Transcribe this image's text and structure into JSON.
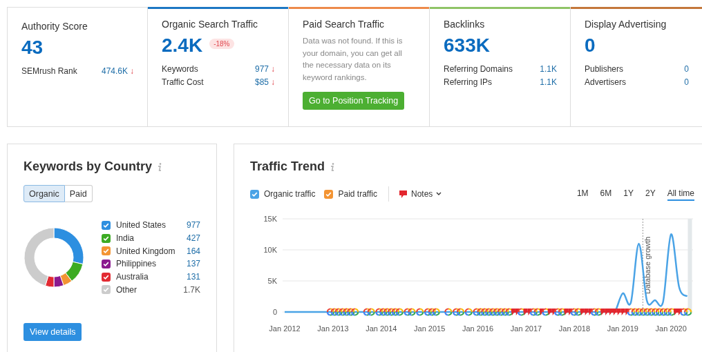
{
  "summary_cards": [
    {
      "title": "Authority Score",
      "value": "43",
      "metrics": [
        {
          "label": "SEMrush Rank",
          "value": "474.6K",
          "trend_icon": "↓"
        }
      ]
    },
    {
      "title": "Organic Search Traffic",
      "color": "#1c77c3",
      "value": "2.4K",
      "badge": "-18%",
      "metrics": [
        {
          "label": "Keywords",
          "value": "977",
          "trend_icon": "↓"
        },
        {
          "label": "Traffic Cost",
          "value": "$85",
          "trend_icon": "↓"
        }
      ]
    },
    {
      "title": "Paid Search Traffic",
      "color": "#ed8a4a",
      "message": "Data was not found. If this is your domain, you can get all the necessary data on its keyword rankings.",
      "button": "Go to Position Tracking"
    },
    {
      "title": "Backlinks",
      "color": "#8fc466",
      "value": "633K",
      "metrics": [
        {
          "label": "Referring Domains",
          "value": "1.1K"
        },
        {
          "label": "Referring IPs",
          "value": "1.1K"
        }
      ]
    },
    {
      "title": "Display Advertising",
      "color": "#c4773a",
      "value": "0",
      "metrics": [
        {
          "label": "Publishers",
          "value": "0"
        },
        {
          "label": "Advertisers",
          "value": "0"
        }
      ]
    }
  ],
  "keywords_by_country": {
    "title": "Keywords by Country",
    "toggle": [
      {
        "label": "Organic",
        "selected": true
      },
      {
        "label": "Paid",
        "selected": false
      }
    ],
    "legend": [
      {
        "label": "United States",
        "value": "977",
        "color": "#2d8fe0",
        "checked": true
      },
      {
        "label": "India",
        "value": "427",
        "color": "#3cab23",
        "checked": true
      },
      {
        "label": "United Kingdom",
        "value": "164",
        "color": "#f39433",
        "checked": true
      },
      {
        "label": "Philippines",
        "value": "137",
        "color": "#8b1a8f",
        "checked": true
      },
      {
        "label": "Australia",
        "value": "131",
        "color": "#e22a32",
        "checked": true
      },
      {
        "label": "Other",
        "value": "1.7K",
        "color": "#cccccc",
        "checked": true
      }
    ],
    "chart_data": {
      "type": "donut",
      "series": [
        {
          "values": [
            28.6,
            11.1,
            5,
            5.3,
            4.7,
            45.3
          ]
        }
      ]
    },
    "button": "View details"
  },
  "traffic_trend": {
    "title": "Traffic Trend",
    "toggles": [
      {
        "label": "Organic traffic",
        "checked": true,
        "color": "#4aa3e6"
      },
      {
        "label": "Paid traffic",
        "checked": true,
        "color": "#f39433"
      }
    ],
    "notes_button": "Notes",
    "periods": [
      {
        "label": "1M",
        "selected": false
      },
      {
        "label": "6M",
        "selected": false
      },
      {
        "label": "1Y",
        "selected": false
      },
      {
        "label": "2Y",
        "selected": false
      },
      {
        "label": "All time",
        "selected": true
      }
    ],
    "chart_data": {
      "type": "line",
      "categories": [
        "Jan 2012",
        null,
        null,
        null,
        null,
        null,
        "Jan 2013",
        null,
        null,
        null,
        null,
        null,
        "Jan 2014",
        null,
        null,
        null,
        null,
        null,
        "Jan 2015",
        null,
        null,
        null,
        null,
        null,
        "Jan 2016",
        null,
        null,
        null,
        null,
        null,
        "Jan 2017",
        null,
        null,
        null,
        null,
        null,
        "Jan 2018",
        null,
        null,
        null,
        null,
        null,
        "Jan 2019",
        null,
        null,
        null,
        null,
        null,
        "Jan 2020",
        null,
        null
      ],
      "series": [
        {
          "color": "#4aa3e6",
          "values": [
            0,
            0,
            0,
            0,
            0,
            0,
            0,
            0,
            0,
            0,
            0,
            0,
            0,
            0,
            0,
            0,
            0,
            0,
            0,
            0,
            0,
            0,
            0,
            0,
            0,
            0,
            0,
            0,
            0,
            0,
            0,
            0,
            0,
            0,
            0,
            0,
            0,
            0,
            0,
            0,
            0,
            0,
            3000,
            1500,
            11000,
            1800,
            1900,
            1600,
            12500,
            4000,
            2500
          ]
        }
      ],
      "ylim": [
        0,
        15000
      ],
      "yticks": [
        {
          "value": 0,
          "label": "0"
        },
        {
          "value": 5000,
          "label": "5K"
        },
        {
          "value": 10000,
          "label": "10K"
        },
        {
          "value": 15000,
          "label": "15K"
        }
      ],
      "annotations": [
        {
          "text": "Database growth"
        }
      ]
    }
  }
}
